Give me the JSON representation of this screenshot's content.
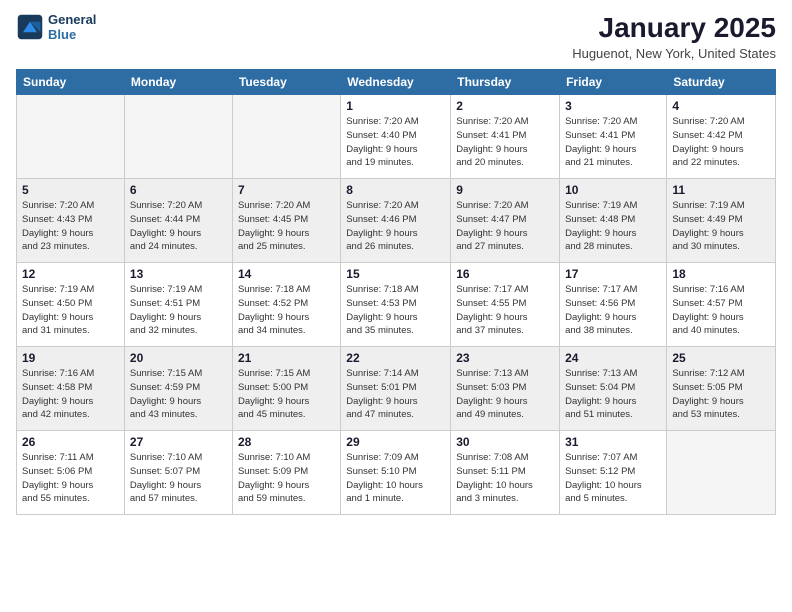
{
  "logo": {
    "line1": "General",
    "line2": "Blue"
  },
  "header": {
    "month": "January 2025",
    "location": "Huguenot, New York, United States"
  },
  "weekdays": [
    "Sunday",
    "Monday",
    "Tuesday",
    "Wednesday",
    "Thursday",
    "Friday",
    "Saturday"
  ],
  "weeks": [
    [
      {
        "day": "",
        "info": ""
      },
      {
        "day": "",
        "info": ""
      },
      {
        "day": "",
        "info": ""
      },
      {
        "day": "1",
        "info": "Sunrise: 7:20 AM\nSunset: 4:40 PM\nDaylight: 9 hours\nand 19 minutes."
      },
      {
        "day": "2",
        "info": "Sunrise: 7:20 AM\nSunset: 4:41 PM\nDaylight: 9 hours\nand 20 minutes."
      },
      {
        "day": "3",
        "info": "Sunrise: 7:20 AM\nSunset: 4:41 PM\nDaylight: 9 hours\nand 21 minutes."
      },
      {
        "day": "4",
        "info": "Sunrise: 7:20 AM\nSunset: 4:42 PM\nDaylight: 9 hours\nand 22 minutes."
      }
    ],
    [
      {
        "day": "5",
        "info": "Sunrise: 7:20 AM\nSunset: 4:43 PM\nDaylight: 9 hours\nand 23 minutes."
      },
      {
        "day": "6",
        "info": "Sunrise: 7:20 AM\nSunset: 4:44 PM\nDaylight: 9 hours\nand 24 minutes."
      },
      {
        "day": "7",
        "info": "Sunrise: 7:20 AM\nSunset: 4:45 PM\nDaylight: 9 hours\nand 25 minutes."
      },
      {
        "day": "8",
        "info": "Sunrise: 7:20 AM\nSunset: 4:46 PM\nDaylight: 9 hours\nand 26 minutes."
      },
      {
        "day": "9",
        "info": "Sunrise: 7:20 AM\nSunset: 4:47 PM\nDaylight: 9 hours\nand 27 minutes."
      },
      {
        "day": "10",
        "info": "Sunrise: 7:19 AM\nSunset: 4:48 PM\nDaylight: 9 hours\nand 28 minutes."
      },
      {
        "day": "11",
        "info": "Sunrise: 7:19 AM\nSunset: 4:49 PM\nDaylight: 9 hours\nand 30 minutes."
      }
    ],
    [
      {
        "day": "12",
        "info": "Sunrise: 7:19 AM\nSunset: 4:50 PM\nDaylight: 9 hours\nand 31 minutes."
      },
      {
        "day": "13",
        "info": "Sunrise: 7:19 AM\nSunset: 4:51 PM\nDaylight: 9 hours\nand 32 minutes."
      },
      {
        "day": "14",
        "info": "Sunrise: 7:18 AM\nSunset: 4:52 PM\nDaylight: 9 hours\nand 34 minutes."
      },
      {
        "day": "15",
        "info": "Sunrise: 7:18 AM\nSunset: 4:53 PM\nDaylight: 9 hours\nand 35 minutes."
      },
      {
        "day": "16",
        "info": "Sunrise: 7:17 AM\nSunset: 4:55 PM\nDaylight: 9 hours\nand 37 minutes."
      },
      {
        "day": "17",
        "info": "Sunrise: 7:17 AM\nSunset: 4:56 PM\nDaylight: 9 hours\nand 38 minutes."
      },
      {
        "day": "18",
        "info": "Sunrise: 7:16 AM\nSunset: 4:57 PM\nDaylight: 9 hours\nand 40 minutes."
      }
    ],
    [
      {
        "day": "19",
        "info": "Sunrise: 7:16 AM\nSunset: 4:58 PM\nDaylight: 9 hours\nand 42 minutes."
      },
      {
        "day": "20",
        "info": "Sunrise: 7:15 AM\nSunset: 4:59 PM\nDaylight: 9 hours\nand 43 minutes."
      },
      {
        "day": "21",
        "info": "Sunrise: 7:15 AM\nSunset: 5:00 PM\nDaylight: 9 hours\nand 45 minutes."
      },
      {
        "day": "22",
        "info": "Sunrise: 7:14 AM\nSunset: 5:01 PM\nDaylight: 9 hours\nand 47 minutes."
      },
      {
        "day": "23",
        "info": "Sunrise: 7:13 AM\nSunset: 5:03 PM\nDaylight: 9 hours\nand 49 minutes."
      },
      {
        "day": "24",
        "info": "Sunrise: 7:13 AM\nSunset: 5:04 PM\nDaylight: 9 hours\nand 51 minutes."
      },
      {
        "day": "25",
        "info": "Sunrise: 7:12 AM\nSunset: 5:05 PM\nDaylight: 9 hours\nand 53 minutes."
      }
    ],
    [
      {
        "day": "26",
        "info": "Sunrise: 7:11 AM\nSunset: 5:06 PM\nDaylight: 9 hours\nand 55 minutes."
      },
      {
        "day": "27",
        "info": "Sunrise: 7:10 AM\nSunset: 5:07 PM\nDaylight: 9 hours\nand 57 minutes."
      },
      {
        "day": "28",
        "info": "Sunrise: 7:10 AM\nSunset: 5:09 PM\nDaylight: 9 hours\nand 59 minutes."
      },
      {
        "day": "29",
        "info": "Sunrise: 7:09 AM\nSunset: 5:10 PM\nDaylight: 10 hours\nand 1 minute."
      },
      {
        "day": "30",
        "info": "Sunrise: 7:08 AM\nSunset: 5:11 PM\nDaylight: 10 hours\nand 3 minutes."
      },
      {
        "day": "31",
        "info": "Sunrise: 7:07 AM\nSunset: 5:12 PM\nDaylight: 10 hours\nand 5 minutes."
      },
      {
        "day": "",
        "info": ""
      }
    ]
  ]
}
